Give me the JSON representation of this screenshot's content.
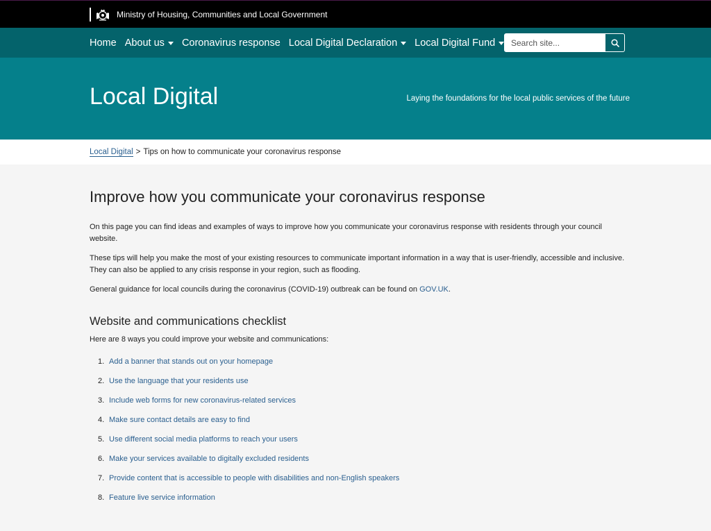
{
  "topbar": {
    "department": "Ministry of Housing, Communities and Local Government",
    "crest_icon": "royal-crest-icon"
  },
  "nav": {
    "items": [
      {
        "label": "Home",
        "dropdown": false
      },
      {
        "label": "About us",
        "dropdown": true
      },
      {
        "label": "Coronavirus response",
        "dropdown": false
      },
      {
        "label": "Local Digital Declaration",
        "dropdown": true
      },
      {
        "label": "Local Digital Fund",
        "dropdown": true
      }
    ],
    "search_placeholder": "Search site...",
    "search_icon": "search-icon"
  },
  "hero": {
    "title": "Local Digital",
    "tagline": "Laying the foundations for the local public services of the future"
  },
  "breadcrumb": {
    "home": "Local Digital",
    "separator": ">",
    "current": "Tips on how to communicate your coronavirus response"
  },
  "main": {
    "heading": "Improve how you communicate your coronavirus response",
    "para1": "On this page you can find ideas and examples of ways to improve how you communicate your coronavirus response with residents through your council website.",
    "para2": "These tips will help you make the most of your existing resources to communicate important information in a way that is user-friendly, accessible and inclusive. They can also be applied to any crisis response in your region, such as flooding.",
    "para3_text": "General guidance for local councils during the coronavirus (COVID-19) outbreak can be found on ",
    "para3_link": "GOV.UK",
    "para3_end": ".",
    "checklist_heading": "Website and communications checklist",
    "checklist_intro": "Here are 8 ways you could improve your website and communications:",
    "checklist": [
      {
        "num": "1.",
        "label": "Add a banner that stands out on your homepage"
      },
      {
        "num": "2.",
        "label": "Use the language that your residents use"
      },
      {
        "num": "3.",
        "label": "Include web forms for new coronavirus-related services"
      },
      {
        "num": "4.",
        "label": "Make sure contact details are easy to find"
      },
      {
        "num": "5.",
        "label": "Use different social media platforms to reach your users"
      },
      {
        "num": "6.",
        "label": "Make your services available to digitally excluded residents"
      },
      {
        "num": "7.",
        "label": "Provide content that is accessible to people with disabilities and non-English speakers"
      },
      {
        "num": "8.",
        "label": "Feature live service information"
      }
    ]
  },
  "colors": {
    "topbar": "#000000",
    "nav": "#04636b",
    "hero": "#05808b",
    "link": "#2a5f8f",
    "page_bg": "#f5f5f5"
  }
}
